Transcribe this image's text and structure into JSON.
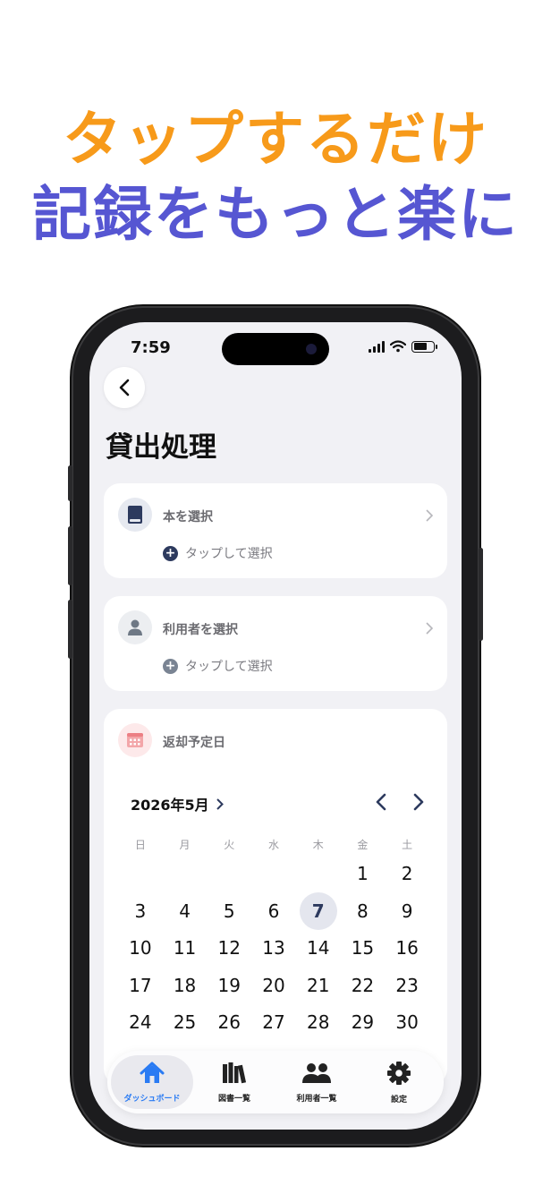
{
  "promo": {
    "line1": "タップするだけ",
    "line2": "記録をもっと楽に",
    "line1_color": "#f79a1a",
    "line2_color": "#5656d2"
  },
  "status_bar": {
    "time": "7:59",
    "icons": [
      "signal-icon",
      "wifi-icon",
      "battery-icon"
    ]
  },
  "screen": {
    "back_icon": "chevron-left-icon",
    "title": "貸出処理"
  },
  "book_card": {
    "icon": "book-icon",
    "label": "本を選択",
    "action_icon": "plus-circle-icon",
    "action": "タップして選択"
  },
  "user_card": {
    "icon": "person-icon",
    "label": "利用者を選択",
    "action_icon": "plus-circle-icon",
    "action": "タップして選択"
  },
  "due_card": {
    "icon": "calendar-icon",
    "label": "返却予定日",
    "month": "2026年5月",
    "weekdays": [
      "日",
      "月",
      "火",
      "水",
      "木",
      "金",
      "土"
    ],
    "days": [
      "",
      "",
      "",
      "",
      "",
      "1",
      "2",
      "3",
      "4",
      "5",
      "6",
      "7",
      "8",
      "9",
      "10",
      "11",
      "12",
      "13",
      "14",
      "15",
      "16",
      "17",
      "18",
      "19",
      "20",
      "21",
      "22",
      "23",
      "24",
      "25",
      "26",
      "27",
      "28",
      "29",
      "30"
    ],
    "selected_day": "7"
  },
  "tabbar": {
    "tabs": [
      {
        "label": "ダッシュボード",
        "icon": "house-icon",
        "active": true
      },
      {
        "label": "図書一覧",
        "icon": "books-icon",
        "active": false
      },
      {
        "label": "利用者一覧",
        "icon": "people-icon",
        "active": false
      },
      {
        "label": "設定",
        "icon": "gear-icon",
        "active": false
      }
    ]
  },
  "colors": {
    "accent": "#2a7bf3",
    "navy": "#2d3a5e",
    "background": "#f1f1f5"
  }
}
